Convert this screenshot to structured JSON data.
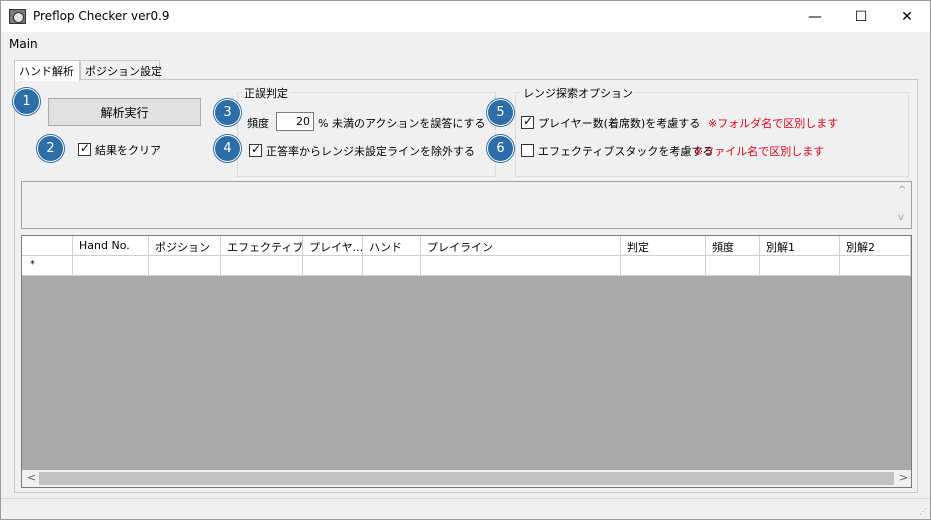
{
  "window": {
    "title": "Preflop Checker ver0.9",
    "minimize": "—",
    "maximize": "☐",
    "close": "✕"
  },
  "menu": {
    "main": "Main"
  },
  "tabs": [
    {
      "label": "ハンド解析",
      "active": true
    },
    {
      "label": "ポジション設定",
      "active": false
    }
  ],
  "controls": {
    "analyze_button": "解析実行",
    "clear_results": {
      "label": "結果をクリア",
      "checked": true
    },
    "correctness_group": {
      "title": "正誤判定",
      "frequency_label": "頻度",
      "frequency_value": "20",
      "frequency_suffix": "% 未満のアクションを誤答にする",
      "exclude_unset": {
        "label": "正答率からレンジ未設定ラインを除外する",
        "checked": true
      }
    },
    "range_group": {
      "title": "レンジ探索オプション",
      "consider_players": {
        "label": "プレイヤー数(着席数)を考慮する",
        "checked": true,
        "note": "※フォルダ名で区別します"
      },
      "consider_stack": {
        "label": "エフェクティブスタックを考慮する",
        "checked": false,
        "note": "※ファイル名で区別します"
      }
    }
  },
  "badges": [
    "1",
    "2",
    "3",
    "4",
    "5",
    "6"
  ],
  "grid": {
    "columns": [
      "",
      "Hand No.",
      "ポジション",
      "エフェクティブ...",
      "プレイヤ...",
      "ハンド",
      "プレイライン",
      "判定",
      "頻度",
      "別解1",
      "別解2"
    ],
    "new_row_marker": "*"
  },
  "scroll": {
    "left": "<",
    "right": ">",
    "up": "^",
    "down": "v"
  },
  "colors": {
    "badge": "#2d6da8",
    "note_red": "#e0001a",
    "grid_bg": "#a9a9a9"
  }
}
